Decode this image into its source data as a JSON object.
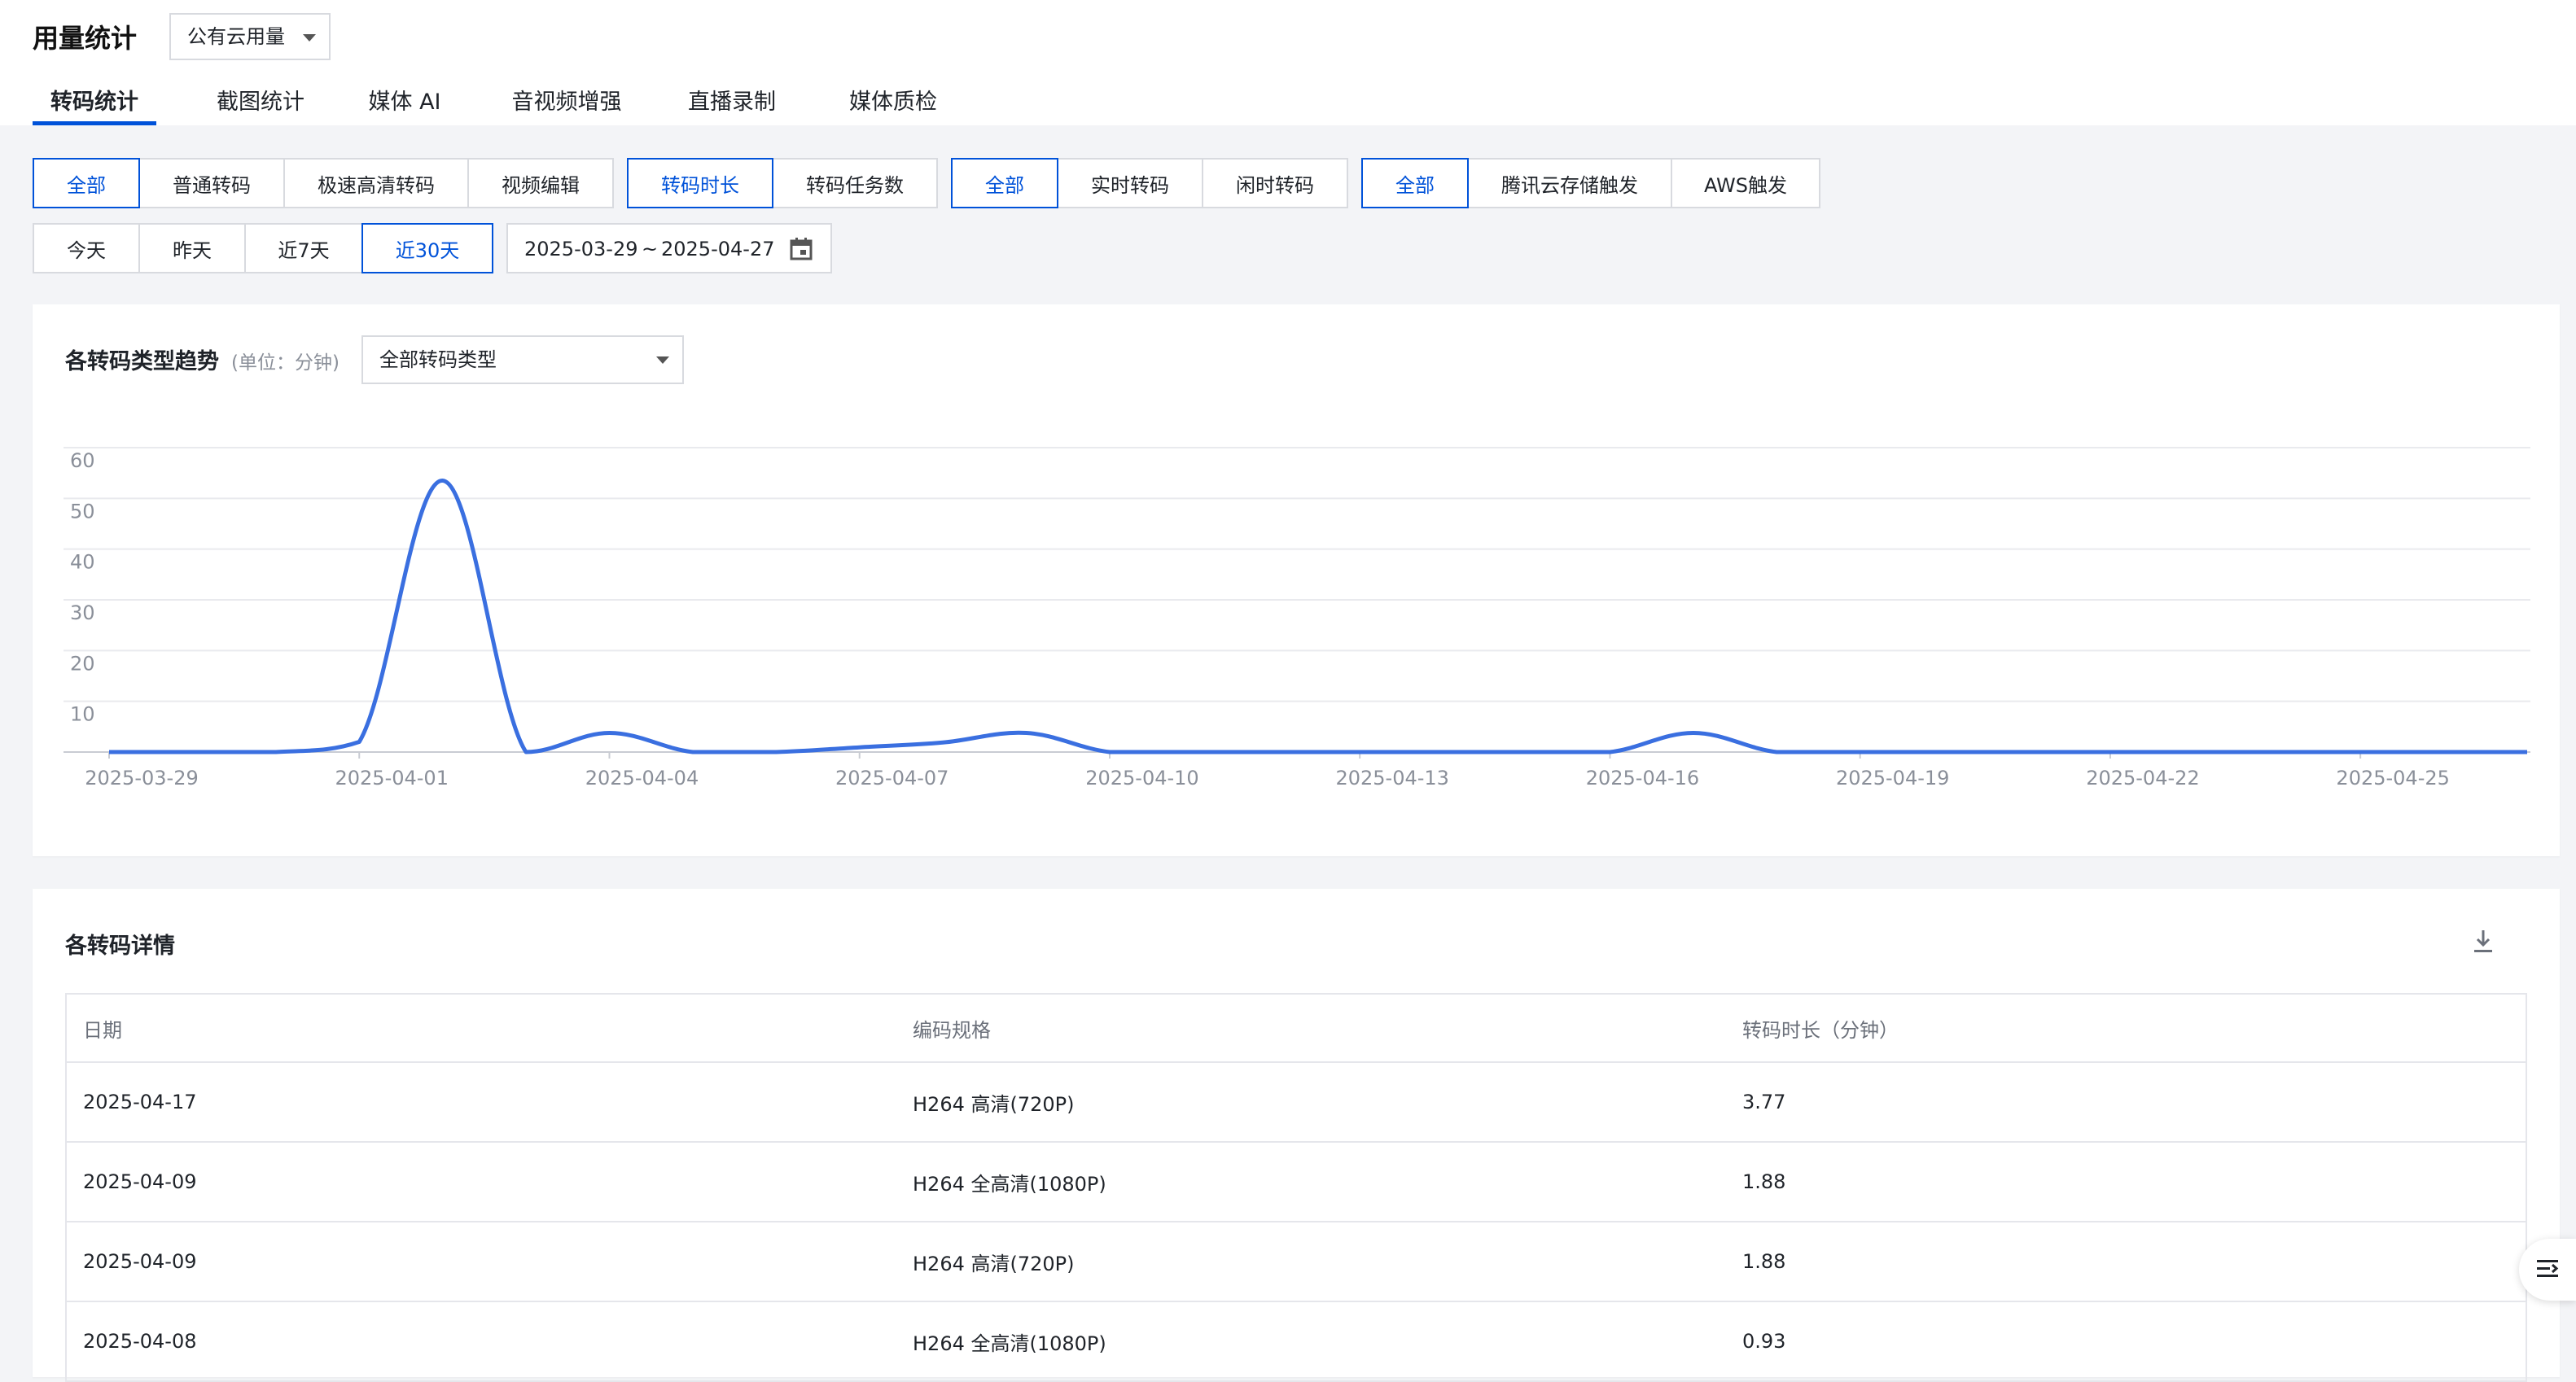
{
  "header": {
    "title": "用量统计",
    "scope_select": "公有云用量",
    "tabs": [
      "转码统计",
      "截图统计",
      "媒体 AI",
      "音视频增强",
      "直播录制",
      "媒体质检"
    ],
    "active_tab": 0
  },
  "filters": {
    "transcode_type": [
      "全部",
      "普通转码",
      "极速高清转码",
      "视频编辑"
    ],
    "metric": [
      "转码时长",
      "转码任务数"
    ],
    "mode": [
      "全部",
      "实时转码",
      "闲时转码"
    ],
    "trigger": [
      "全部",
      "腾讯云存储触发",
      "AWS触发"
    ],
    "period": [
      "今天",
      "昨天",
      "近7天",
      "近30天"
    ],
    "date_start": "2025-03-29",
    "date_sep": "~",
    "date_end": "2025-04-27"
  },
  "chart_card": {
    "title": "各转码类型趋势",
    "unit": "(单位：分钟)",
    "type_select": "全部转码类型"
  },
  "chart_data": {
    "type": "line",
    "title": "各转码类型趋势",
    "xlabel": "",
    "ylabel": "",
    "ylim": [
      0,
      60
    ],
    "yticks": [
      10,
      20,
      30,
      40,
      50,
      60
    ],
    "x_tick_labels": [
      "2025-03-29",
      "2025-04-01",
      "2025-04-04",
      "2025-04-07",
      "2025-04-10",
      "2025-04-13",
      "2025-04-16",
      "2025-04-19",
      "2025-04-22",
      "2025-04-25"
    ],
    "x": [
      "2025-03-29",
      "2025-03-30",
      "2025-03-31",
      "2025-04-01",
      "2025-04-02",
      "2025-04-03",
      "2025-04-04",
      "2025-04-05",
      "2025-04-06",
      "2025-04-07",
      "2025-04-08",
      "2025-04-09",
      "2025-04-10",
      "2025-04-11",
      "2025-04-12",
      "2025-04-13",
      "2025-04-14",
      "2025-04-15",
      "2025-04-16",
      "2025-04-17",
      "2025-04-18",
      "2025-04-19",
      "2025-04-20",
      "2025-04-21",
      "2025-04-22",
      "2025-04-23",
      "2025-04-24",
      "2025-04-25",
      "2025-04-26",
      "2025-04-27"
    ],
    "series": [
      {
        "color": "#3a6fe0",
        "values": [
          0,
          0,
          0,
          2,
          53.5,
          0,
          3.77,
          0,
          0,
          0.93,
          1.88,
          3.77,
          0,
          0,
          0,
          0,
          0,
          0,
          0,
          3.77,
          0,
          0,
          0,
          0,
          0,
          0,
          0,
          0,
          0,
          0
        ]
      }
    ],
    "grid": true,
    "legend": "none"
  },
  "table_card": {
    "title": "各转码详情",
    "columns": [
      "日期",
      "编码规格",
      "转码时长（分钟）"
    ],
    "rows": [
      [
        "2025-04-17",
        "H264 高清(720P)",
        "3.77"
      ],
      [
        "2025-04-09",
        "H264 全高清(1080P)",
        "1.88"
      ],
      [
        "2025-04-09",
        "H264 高清(720P)",
        "1.88"
      ],
      [
        "2025-04-08",
        "H264 全高清(1080P)",
        "0.93"
      ]
    ]
  }
}
